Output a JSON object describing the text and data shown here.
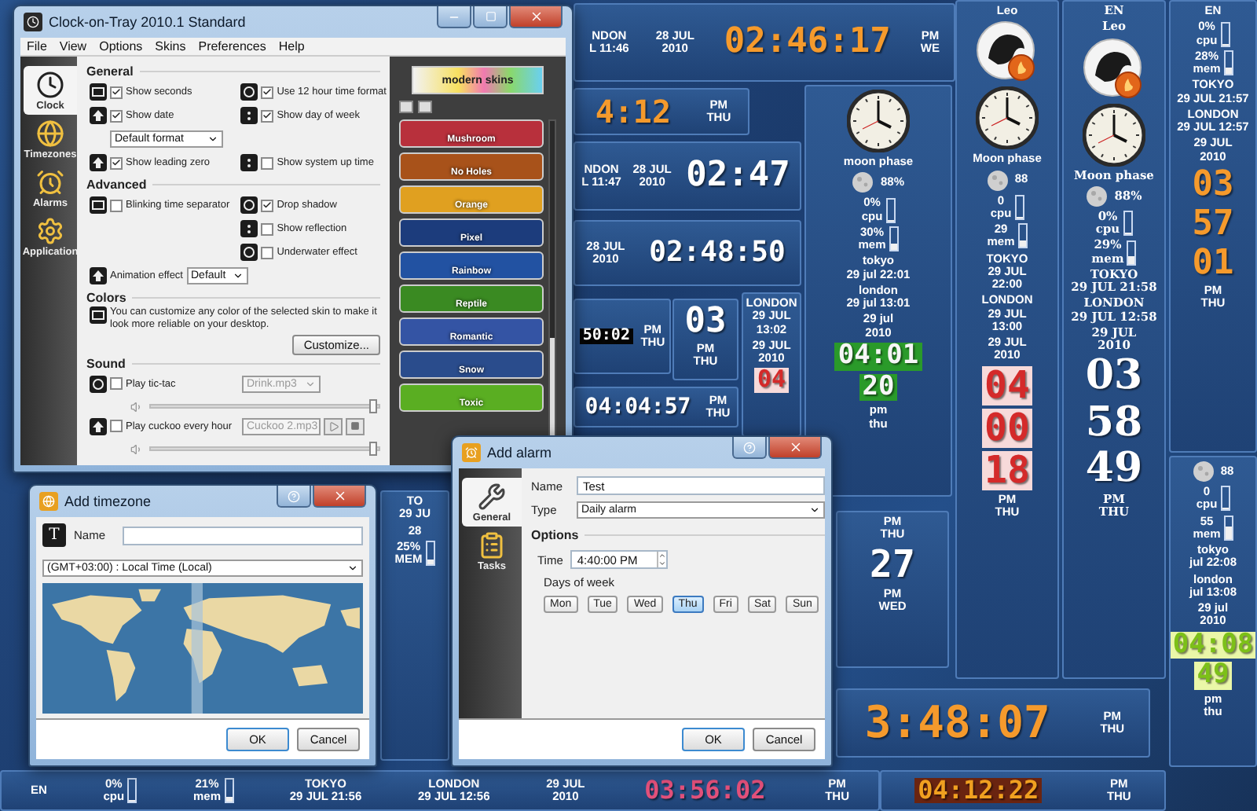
{
  "main_window": {
    "title": "Clock-on-Tray 2010.1 Standard",
    "menu": [
      "File",
      "View",
      "Options",
      "Skins",
      "Preferences",
      "Help"
    ],
    "sidebar": [
      {
        "label": "Clock",
        "selected": true
      },
      {
        "label": "Timezones",
        "selected": false
      },
      {
        "label": "Alarms",
        "selected": false
      },
      {
        "label": "Application",
        "selected": false
      }
    ],
    "sections": [
      {
        "title": "General",
        "rows": [
          [
            {
              "kind": "check",
              "label": "Show seconds",
              "checked": true
            },
            {
              "kind": "check",
              "label": "Use 12 hour time format",
              "checked": true
            }
          ],
          [
            {
              "kind": "check",
              "label": "Show date",
              "checked": true
            },
            {
              "kind": "check",
              "label": "Show day of week",
              "checked": true
            }
          ],
          [
            {
              "kind": "select",
              "value": "Default format"
            },
            null
          ],
          [
            {
              "kind": "check",
              "label": "Show leading zero",
              "checked": true
            },
            {
              "kind": "check",
              "label": "Show system up time",
              "checked": false
            }
          ]
        ]
      },
      {
        "title": "Advanced",
        "rows": [
          [
            {
              "kind": "check",
              "label": "Blinking time separator",
              "checked": false
            },
            {
              "kind": "check",
              "label": "Drop shadow",
              "checked": true
            }
          ],
          [
            null,
            {
              "kind": "check",
              "label": "Show reflection",
              "checked": false
            }
          ],
          [
            null,
            {
              "kind": "check",
              "label": "Underwater effect",
              "checked": false
            }
          ],
          [
            {
              "kind": "labeled_select",
              "label": "Animation effect",
              "value": "Default"
            },
            null
          ]
        ]
      },
      {
        "title": "Colors",
        "rows": [
          [
            {
              "kind": "note",
              "text": "You can customize any color of the selected skin to make it look more reliable on your desktop.",
              "button": "Customize..."
            }
          ]
        ]
      },
      {
        "title": "Sound",
        "rows": [
          [
            {
              "kind": "sound",
              "label": "Play tic-tac",
              "checked": false,
              "file": "Drink.mp3",
              "preview": false,
              "level": 0.97
            }
          ],
          [
            {
              "kind": "sound",
              "label": "Play cuckoo every hour",
              "checked": false,
              "file": "Cuckoo 2.mp3",
              "preview": true,
              "level": 0.97
            }
          ]
        ]
      }
    ],
    "skins": {
      "banner": "modern skins",
      "items": [
        {
          "name": "Mushroom",
          "color": "#b8303c"
        },
        {
          "name": "No Holes",
          "color": "#a8521a"
        },
        {
          "name": "Orange",
          "color": "#e0a020"
        },
        {
          "name": "Pixel",
          "color": "#1c3c7c"
        },
        {
          "name": "Rainbow",
          "color": "#2252a2"
        },
        {
          "name": "Reptile",
          "color": "#3a8a22"
        },
        {
          "name": "Romantic",
          "color": "#3454a4"
        },
        {
          "name": "Snow",
          "color": "#2a4c8c"
        },
        {
          "name": "Toxic",
          "color": "#5aae22"
        }
      ]
    }
  },
  "widgets": [
    {
      "kind": "orange",
      "parts": [
        {
          "kind": "label",
          "lines": [
            "NDON",
            "L 11:46"
          ]
        },
        {
          "kind": "label",
          "lines": [
            "28 JUL",
            "2010"
          ]
        },
        {
          "kind": "digits",
          "text": "02:46:17"
        },
        {
          "kind": "label",
          "lines": [
            "PM",
            "WE"
          ]
        }
      ]
    },
    {
      "kind": "orange",
      "parts": [
        {
          "kind": "digits",
          "text": "4:12"
        },
        {
          "kind": "label",
          "lines": [
            "PM",
            "THU"
          ]
        }
      ]
    },
    {
      "kind": "white",
      "parts": [
        {
          "kind": "label",
          "lines": [
            "NDON",
            "L 11:47"
          ]
        },
        {
          "kind": "label",
          "lines": [
            "28 JUL",
            "2010"
          ]
        },
        {
          "kind": "digits",
          "text": "02:47"
        }
      ]
    },
    {
      "kind": "white",
      "parts": [
        {
          "kind": "label",
          "lines": [
            "28 JUL",
            "2010"
          ]
        },
        {
          "kind": "digits",
          "text": "02:48:50"
        }
      ]
    },
    {
      "kind": "lcd",
      "parts": [
        {
          "kind": "digits",
          "text": "50:02"
        },
        {
          "kind": "label",
          "lines": [
            "PM",
            "THU"
          ]
        }
      ]
    },
    {
      "kind": "white",
      "parts": [
        {
          "kind": "digits",
          "text": "03"
        },
        {
          "kind": "label",
          "lines": [
            "PM",
            "THU"
          ]
        }
      ]
    },
    {
      "kind": "red",
      "parts": [
        {
          "kind": "label",
          "lines": [
            "LONDON",
            "29 JUL",
            "13:02"
          ]
        },
        {
          "kind": "label",
          "lines": [
            "29 JUL",
            "2010"
          ]
        },
        {
          "kind": "digits",
          "text": "04"
        }
      ]
    },
    {
      "kind": "white",
      "parts": [
        {
          "kind": "digits",
          "text": "04:04:57"
        },
        {
          "kind": "label",
          "lines": [
            "PM",
            "THU"
          ]
        }
      ]
    },
    {
      "kind": "green",
      "parts": [
        {
          "kind": "analog"
        },
        {
          "kind": "label",
          "lines": [
            "moon phase"
          ]
        },
        {
          "kind": "moon",
          "text": "88%"
        },
        {
          "kind": "meter",
          "lines": [
            "0%",
            "cpu"
          ],
          "level": 0
        },
        {
          "kind": "meter",
          "lines": [
            "30%",
            "mem"
          ],
          "level": 0.3
        },
        {
          "kind": "label",
          "lines": [
            "tokyo",
            "29 jul 22:01"
          ]
        },
        {
          "kind": "label",
          "lines": [
            "london",
            "29 jul 13:01"
          ]
        },
        {
          "kind": "label",
          "lines": [
            "29 jul",
            "2010"
          ]
        },
        {
          "kind": "digits",
          "text": "04:01"
        },
        {
          "kind": "digits",
          "text": "20"
        },
        {
          "kind": "label",
          "lines": [
            "pm",
            "thu"
          ]
        }
      ]
    },
    {
      "kind": "red",
      "parts": [
        {
          "kind": "zodiac",
          "text": "Leo"
        },
        {
          "kind": "analog"
        },
        {
          "kind": "label",
          "lines": [
            "Moon phase"
          ]
        },
        {
          "kind": "moon",
          "text": "88"
        },
        {
          "kind": "meter",
          "lines": [
            "0",
            "cpu"
          ],
          "level": 0
        },
        {
          "kind": "meter",
          "lines": [
            "29",
            "mem"
          ],
          "level": 0.29
        },
        {
          "kind": "label",
          "lines": [
            "TOKYO",
            "29 JUL",
            "22:00"
          ]
        },
        {
          "kind": "label",
          "lines": [
            "LONDON",
            "29 JUL",
            "13:00"
          ]
        },
        {
          "kind": "label",
          "lines": [
            "29 JUL",
            "2010"
          ]
        },
        {
          "kind": "digits",
          "text": "04"
        },
        {
          "kind": "digits",
          "text": "00"
        },
        {
          "kind": "digits",
          "text": "18"
        },
        {
          "kind": "label",
          "lines": [
            "PM",
            "THU"
          ]
        }
      ]
    },
    {
      "kind": "serif",
      "parts": [
        {
          "kind": "label",
          "lines": [
            "EN"
          ]
        },
        {
          "kind": "zodiac",
          "text": "Leo"
        },
        {
          "kind": "analog"
        },
        {
          "kind": "label",
          "lines": [
            "Moon phase"
          ]
        },
        {
          "kind": "moon",
          "text": "88%"
        },
        {
          "kind": "meter",
          "lines": [
            "0%",
            "cpu"
          ],
          "level": 0
        },
        {
          "kind": "meter",
          "lines": [
            "29%",
            "mem"
          ],
          "level": 0.29
        },
        {
          "kind": "label",
          "lines": [
            "TOKYO",
            "29 JUL 21:58"
          ]
        },
        {
          "kind": "label",
          "lines": [
            "LONDON",
            "29 JUL 12:58"
          ]
        },
        {
          "kind": "label",
          "lines": [
            "29 JUL",
            "2010"
          ]
        },
        {
          "kind": "digits",
          "text": "03"
        },
        {
          "kind": "digits",
          "text": "58"
        },
        {
          "kind": "digits",
          "text": "49"
        },
        {
          "kind": "label",
          "lines": [
            "PM",
            "THU"
          ]
        }
      ]
    },
    {
      "kind": "orange",
      "parts": [
        {
          "kind": "label",
          "lines": [
            "EN"
          ]
        },
        {
          "kind": "meter",
          "lines": [
            "0%",
            "cpu"
          ],
          "level": 0
        },
        {
          "kind": "meter",
          "lines": [
            "28%",
            "mem"
          ],
          "level": 0.28
        },
        {
          "kind": "label",
          "lines": [
            "TOKYO",
            "29 JUL 21:57"
          ]
        },
        {
          "kind": "label",
          "lines": [
            "LONDON",
            "29 JUL 12:57"
          ]
        },
        {
          "kind": "label",
          "lines": [
            "29 JUL",
            "2010"
          ]
        },
        {
          "kind": "digits",
          "text": "03"
        },
        {
          "kind": "digits",
          "text": "57"
        },
        {
          "kind": "digits",
          "text": "01"
        },
        {
          "kind": "label",
          "lines": [
            "PM",
            "THU"
          ]
        }
      ]
    },
    {
      "kind": "lime",
      "parts": [
        {
          "kind": "moon",
          "text": "88"
        },
        {
          "kind": "meter",
          "lines": [
            "0",
            "cpu"
          ],
          "level": 0
        },
        {
          "kind": "meter",
          "lines": [
            "55",
            "mem"
          ],
          "level": 0.55
        },
        {
          "kind": "label",
          "lines": [
            "tokyo",
            "jul 22:08"
          ]
        },
        {
          "kind": "label",
          "lines": [
            "london",
            "jul 13:08"
          ]
        },
        {
          "kind": "label",
          "lines": [
            "29 jul",
            "2010"
          ]
        },
        {
          "kind": "digits",
          "text": "04:08"
        },
        {
          "kind": "digits",
          "text": "49"
        },
        {
          "kind": "label",
          "lines": [
            "pm",
            "thu"
          ]
        }
      ]
    },
    {
      "kind": "white",
      "parts": [
        {
          "kind": "label",
          "lines": [
            "TO",
            "29 JU"
          ]
        },
        {
          "kind": "label",
          "lines": [
            "28"
          ]
        },
        {
          "kind": "meter",
          "lines": [
            "25%",
            "MEM"
          ],
          "level": 0.25
        }
      ]
    },
    {
      "kind": "white",
      "parts": [
        {
          "kind": "label",
          "lines": [
            "PM",
            "THU"
          ]
        },
        {
          "kind": "digits",
          "text": "27"
        },
        {
          "kind": "label",
          "lines": [
            "PM",
            "WED"
          ]
        }
      ]
    },
    {
      "kind": "orange",
      "parts": [
        {
          "kind": "digits",
          "text": "3:48:07"
        },
        {
          "kind": "label",
          "lines": [
            "PM",
            "THU"
          ]
        }
      ]
    },
    {
      "kind": "rose",
      "parts": [
        {
          "kind": "label",
          "lines": [
            "EN"
          ]
        },
        {
          "kind": "meter",
          "lines": [
            "0%",
            "cpu"
          ],
          "level": 0
        },
        {
          "kind": "meter",
          "lines": [
            "21%",
            "mem"
          ],
          "level": 0.21
        },
        {
          "kind": "label",
          "lines": [
            "TOKYO",
            "29 JUL 21:56"
          ]
        },
        {
          "kind": "label",
          "lines": [
            "LONDON",
            "29 JUL 12:56"
          ]
        },
        {
          "kind": "label",
          "lines": [
            "29 JUL",
            "2010"
          ]
        },
        {
          "kind": "digits",
          "text": "03:56:02"
        },
        {
          "kind": "label",
          "lines": [
            "PM",
            "THU"
          ]
        }
      ]
    },
    {
      "kind": "bronze",
      "parts": [
        {
          "kind": "digits",
          "text": "04:12:22"
        },
        {
          "kind": "label",
          "lines": [
            "PM",
            "THU"
          ]
        }
      ]
    }
  ],
  "timezone_dialog": {
    "title": "Add timezone",
    "name_icon": "T",
    "name_label": "Name",
    "zone": "(GMT+03:00) : Local Time (Local)",
    "buttons": [
      "OK",
      "Cancel"
    ]
  },
  "alarm_dialog": {
    "title": "Add alarm",
    "sidebar": [
      {
        "label": "General",
        "selected": true
      },
      {
        "label": "Tasks",
        "selected": false
      }
    ],
    "name_label": "Name",
    "name_value": "Test",
    "type_label": "Type",
    "type_value": "Daily alarm",
    "options_title": "Options",
    "time_label": "Time",
    "time_value": "4:40:00 PM",
    "days_label": "Days of week",
    "days": [
      {
        "label": "Mon",
        "selected": false
      },
      {
        "label": "Tue",
        "selected": false
      },
      {
        "label": "Wed",
        "selected": false
      },
      {
        "label": "Thu",
        "selected": true
      },
      {
        "label": "Fri",
        "selected": false
      },
      {
        "label": "Sat",
        "selected": false
      },
      {
        "label": "Sun",
        "selected": false
      }
    ],
    "buttons": [
      "OK",
      "Cancel"
    ]
  }
}
